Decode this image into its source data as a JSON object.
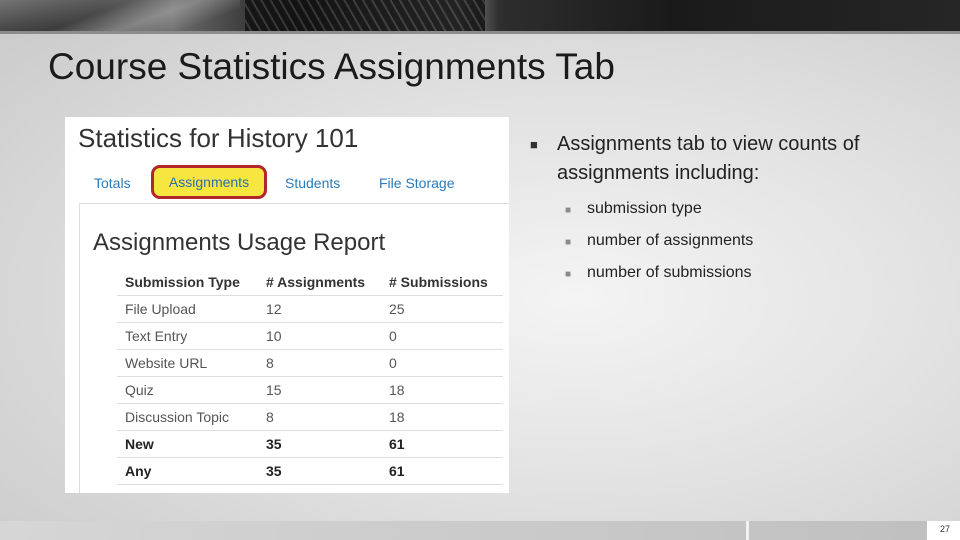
{
  "slide": {
    "title": "Course Statistics Assignments Tab",
    "page_number": "27"
  },
  "screenshot": {
    "heading": "Statistics for History 101",
    "tabs": [
      {
        "label": "Totals",
        "active": false
      },
      {
        "label": "Assignments",
        "active": true
      },
      {
        "label": "Students",
        "active": false
      },
      {
        "label": "File Storage",
        "active": false
      }
    ],
    "report_title": "Assignments Usage Report",
    "columns": [
      "Submission Type",
      "# Assignments",
      "# Submissions"
    ],
    "rows": [
      [
        "File Upload",
        "12",
        "25"
      ],
      [
        "Text Entry",
        "10",
        "0"
      ],
      [
        "Website URL",
        "8",
        "0"
      ],
      [
        "Quiz",
        "15",
        "18"
      ],
      [
        "Discussion Topic",
        "8",
        "18"
      ],
      [
        "New",
        "35",
        "61"
      ],
      [
        "Any",
        "35",
        "61"
      ]
    ],
    "colors": {
      "active_tab_fill": "#f7e640",
      "active_tab_border": "#b1262b",
      "link": "#2a7ab8"
    }
  },
  "bullets": {
    "main": "Assignments tab to view counts of assignments including:",
    "sub": [
      "submission type",
      "number of assignments",
      "number of submissions"
    ]
  }
}
